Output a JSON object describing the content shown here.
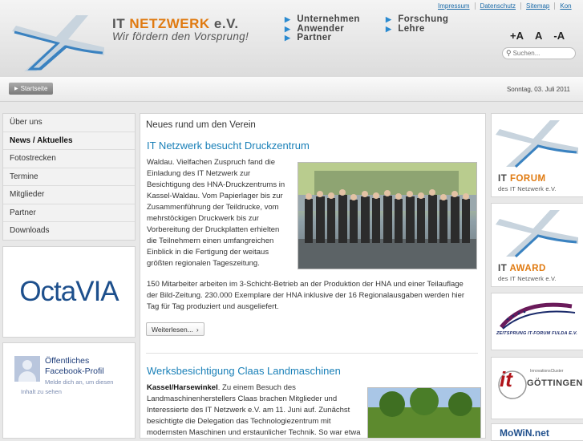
{
  "header": {
    "brand_it": "IT",
    "brand_netzwerk": "NETZWERK",
    "brand_ev": "e.V.",
    "slogan": "Wir fördern den Vorsprung!",
    "nav_col1": [
      "Unternehmen",
      "Anwender",
      "Partner"
    ],
    "nav_col2": [
      "Forschung",
      "Lehre"
    ],
    "utility": [
      "Impressum",
      "Datenschutz",
      "Sitemap",
      "Kon"
    ],
    "font_controls": [
      "+A",
      "A",
      "-A"
    ],
    "search_placeholder": "Suchen..."
  },
  "crumb": {
    "start_label": "Startseite",
    "date": "Sonntag, 03. Juli 2011"
  },
  "leftnav": [
    {
      "label": "Über uns",
      "active": false
    },
    {
      "label": "News / Aktuelles",
      "active": true
    },
    {
      "label": "Fotostrecken",
      "active": false
    },
    {
      "label": "Termine",
      "active": false
    },
    {
      "label": "Mitglieder",
      "active": false
    },
    {
      "label": "Partner",
      "active": false
    },
    {
      "label": "Downloads",
      "active": false
    }
  ],
  "octavia": "OctaVIA",
  "facebook": {
    "line1": "Öffentliches",
    "line2": "Facebook-Profil",
    "line3": "Melde dich an, um diesen",
    "line4": "Inhalt zu sehen"
  },
  "main": {
    "section_title": "Neues rund um den Verein",
    "article1": {
      "title": "IT Netzwerk besucht Druckzentrum",
      "p1": "Waldau. Vielfachen Zuspruch fand die Einladung des IT Netzwerk zur Besichtigung des HNA-Druckzentrums in Kassel-Waldau. Vom Papierlager bis zur Zusammenführung der Teildrucke, vom mehrstöckigen Druckwerk bis zur Vorbereitung der Druckplatten erhielten die Teilnehmern einen umfangreichen Einblick in die Fertigung der weitaus größten regionalen Tageszeitung.",
      "p2": "150 Mitarbeiter arbeiten im 3-Schicht-Betrieb an der Produktion der HNA und einer Teilauflage der Bild-Zeitung. 230.000 Exemplare der HNA inklusive der 16 Regionalausgaben werden hier Tag für Tag produziert und ausgeliefert.",
      "more": "Weiterlesen..."
    },
    "article2": {
      "title": "Werksbesichtigung Claas Landmaschinen",
      "lead": "Kassel/Harsewinkel",
      "p1": ". Zu einem Besuch des Landmaschinenherstellers Claas brachen Mitglieder und Interessierte des IT Netzwerk e.V. am 11. Juni auf. Zunächst besichtigte die Delegation das Technologiezentrum mit modernsten Maschinen und erstaunlicher Technik. So war etwa"
    }
  },
  "right": {
    "forum_big1": "IT",
    "forum_big2": "FORUM",
    "forum_small": "des IT Netzwerk e.V.",
    "award_big1": "IT",
    "award_big2": "AWARD",
    "award_small": "des IT Netzwerk e.V.",
    "zeitsprung": "ZEITSPRUNG IT-FORUM FULDA E.V.",
    "gott_it": "it",
    "gott_label": "InnovationsCluster",
    "gott_name": "GÖTTINGEN",
    "mowin": "MoWiN.net"
  },
  "colors": {
    "accent_blue": "#1a80b8",
    "brand_orange": "#e07a10",
    "octavia_blue": "#1d4f8c"
  }
}
